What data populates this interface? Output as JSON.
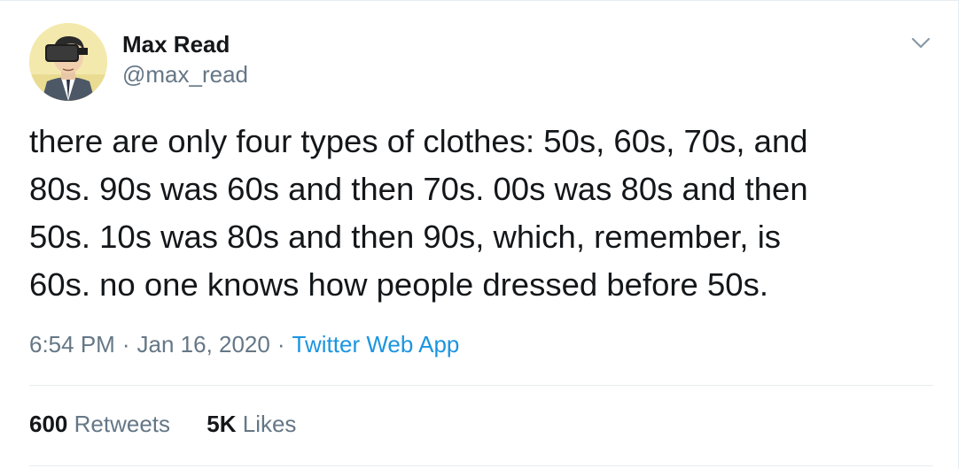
{
  "author": {
    "name": "Max Read",
    "handle": "@max_read"
  },
  "tweet": {
    "lines": [
      "there are only four types of clothes: 50s, 60s, 70s, and",
      "80s. 90s was 60s and then 70s. 00s was 80s and then",
      "50s. 10s was 80s and then 90s, which, remember, is",
      "60s. no one knows how people dressed before 50s."
    ]
  },
  "meta": {
    "time": "6:54 PM",
    "separator": "·",
    "date": "Jan 16, 2020",
    "source": "Twitter Web App"
  },
  "stats": {
    "retweets_count": "600",
    "retweets_label": "Retweets",
    "likes_count": "5K",
    "likes_label": "Likes"
  },
  "colors": {
    "text": "#14171a",
    "secondary": "#657786",
    "link": "#1b95e0",
    "divider": "#e6ecf0"
  },
  "icons": {
    "menu": "chevron-down-icon",
    "avatar": "vr-headset-man-illustration"
  }
}
